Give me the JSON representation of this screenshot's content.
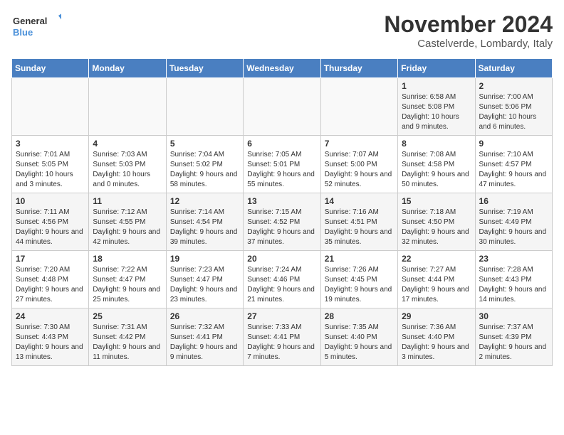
{
  "header": {
    "logo_line1": "General",
    "logo_line2": "Blue",
    "month": "November 2024",
    "location": "Castelverde, Lombardy, Italy"
  },
  "weekdays": [
    "Sunday",
    "Monday",
    "Tuesday",
    "Wednesday",
    "Thursday",
    "Friday",
    "Saturday"
  ],
  "weeks": [
    [
      {
        "day": "",
        "detail": ""
      },
      {
        "day": "",
        "detail": ""
      },
      {
        "day": "",
        "detail": ""
      },
      {
        "day": "",
        "detail": ""
      },
      {
        "day": "",
        "detail": ""
      },
      {
        "day": "1",
        "detail": "Sunrise: 6:58 AM\nSunset: 5:08 PM\nDaylight: 10 hours and 9 minutes."
      },
      {
        "day": "2",
        "detail": "Sunrise: 7:00 AM\nSunset: 5:06 PM\nDaylight: 10 hours and 6 minutes."
      }
    ],
    [
      {
        "day": "3",
        "detail": "Sunrise: 7:01 AM\nSunset: 5:05 PM\nDaylight: 10 hours and 3 minutes."
      },
      {
        "day": "4",
        "detail": "Sunrise: 7:03 AM\nSunset: 5:03 PM\nDaylight: 10 hours and 0 minutes."
      },
      {
        "day": "5",
        "detail": "Sunrise: 7:04 AM\nSunset: 5:02 PM\nDaylight: 9 hours and 58 minutes."
      },
      {
        "day": "6",
        "detail": "Sunrise: 7:05 AM\nSunset: 5:01 PM\nDaylight: 9 hours and 55 minutes."
      },
      {
        "day": "7",
        "detail": "Sunrise: 7:07 AM\nSunset: 5:00 PM\nDaylight: 9 hours and 52 minutes."
      },
      {
        "day": "8",
        "detail": "Sunrise: 7:08 AM\nSunset: 4:58 PM\nDaylight: 9 hours and 50 minutes."
      },
      {
        "day": "9",
        "detail": "Sunrise: 7:10 AM\nSunset: 4:57 PM\nDaylight: 9 hours and 47 minutes."
      }
    ],
    [
      {
        "day": "10",
        "detail": "Sunrise: 7:11 AM\nSunset: 4:56 PM\nDaylight: 9 hours and 44 minutes."
      },
      {
        "day": "11",
        "detail": "Sunrise: 7:12 AM\nSunset: 4:55 PM\nDaylight: 9 hours and 42 minutes."
      },
      {
        "day": "12",
        "detail": "Sunrise: 7:14 AM\nSunset: 4:54 PM\nDaylight: 9 hours and 39 minutes."
      },
      {
        "day": "13",
        "detail": "Sunrise: 7:15 AM\nSunset: 4:52 PM\nDaylight: 9 hours and 37 minutes."
      },
      {
        "day": "14",
        "detail": "Sunrise: 7:16 AM\nSunset: 4:51 PM\nDaylight: 9 hours and 35 minutes."
      },
      {
        "day": "15",
        "detail": "Sunrise: 7:18 AM\nSunset: 4:50 PM\nDaylight: 9 hours and 32 minutes."
      },
      {
        "day": "16",
        "detail": "Sunrise: 7:19 AM\nSunset: 4:49 PM\nDaylight: 9 hours and 30 minutes."
      }
    ],
    [
      {
        "day": "17",
        "detail": "Sunrise: 7:20 AM\nSunset: 4:48 PM\nDaylight: 9 hours and 27 minutes."
      },
      {
        "day": "18",
        "detail": "Sunrise: 7:22 AM\nSunset: 4:47 PM\nDaylight: 9 hours and 25 minutes."
      },
      {
        "day": "19",
        "detail": "Sunrise: 7:23 AM\nSunset: 4:47 PM\nDaylight: 9 hours and 23 minutes."
      },
      {
        "day": "20",
        "detail": "Sunrise: 7:24 AM\nSunset: 4:46 PM\nDaylight: 9 hours and 21 minutes."
      },
      {
        "day": "21",
        "detail": "Sunrise: 7:26 AM\nSunset: 4:45 PM\nDaylight: 9 hours and 19 minutes."
      },
      {
        "day": "22",
        "detail": "Sunrise: 7:27 AM\nSunset: 4:44 PM\nDaylight: 9 hours and 17 minutes."
      },
      {
        "day": "23",
        "detail": "Sunrise: 7:28 AM\nSunset: 4:43 PM\nDaylight: 9 hours and 14 minutes."
      }
    ],
    [
      {
        "day": "24",
        "detail": "Sunrise: 7:30 AM\nSunset: 4:43 PM\nDaylight: 9 hours and 13 minutes."
      },
      {
        "day": "25",
        "detail": "Sunrise: 7:31 AM\nSunset: 4:42 PM\nDaylight: 9 hours and 11 minutes."
      },
      {
        "day": "26",
        "detail": "Sunrise: 7:32 AM\nSunset: 4:41 PM\nDaylight: 9 hours and 9 minutes."
      },
      {
        "day": "27",
        "detail": "Sunrise: 7:33 AM\nSunset: 4:41 PM\nDaylight: 9 hours and 7 minutes."
      },
      {
        "day": "28",
        "detail": "Sunrise: 7:35 AM\nSunset: 4:40 PM\nDaylight: 9 hours and 5 minutes."
      },
      {
        "day": "29",
        "detail": "Sunrise: 7:36 AM\nSunset: 4:40 PM\nDaylight: 9 hours and 3 minutes."
      },
      {
        "day": "30",
        "detail": "Sunrise: 7:37 AM\nSunset: 4:39 PM\nDaylight: 9 hours and 2 minutes."
      }
    ]
  ]
}
